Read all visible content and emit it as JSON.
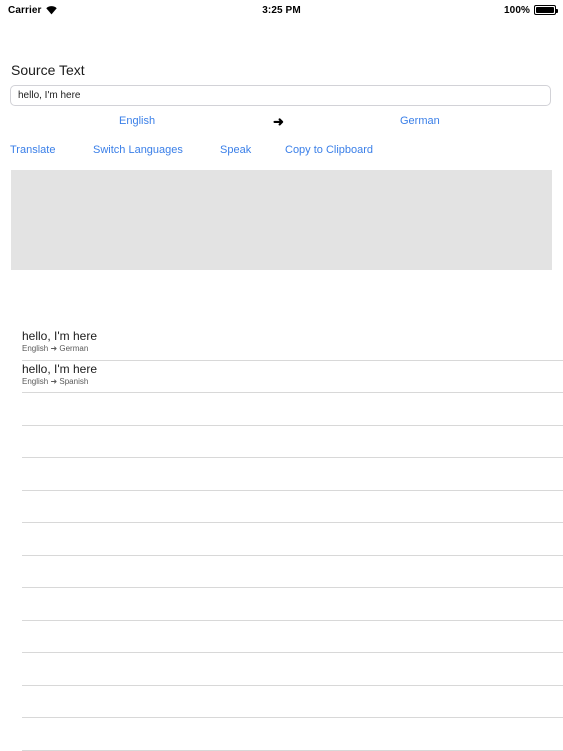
{
  "status_bar": {
    "carrier": "Carrier",
    "wifi_icon": "wifi-icon",
    "time": "3:25 PM",
    "battery_percent": "100%",
    "battery_icon": "battery-full-icon"
  },
  "source": {
    "label": "Source Text",
    "value": "hello, I'm here",
    "placeholder": "Source Text"
  },
  "languages": {
    "source_language": "English",
    "arrow": "➜",
    "target_language": "German"
  },
  "actions": [
    {
      "label": "Translate",
      "name": "translate-button"
    },
    {
      "label": "Switch Languages",
      "name": "switch-languages-button"
    },
    {
      "label": "Speak",
      "name": "speak-button"
    },
    {
      "label": "Copy to Clipboard",
      "name": "copy-to-clipboard-button"
    }
  ],
  "result": {
    "text": ""
  },
  "history": {
    "items": [
      {
        "title": "hello, I'm here",
        "subtitle": "English ➜ German"
      },
      {
        "title": "hello, I'm here",
        "subtitle": "English ➜ Spanish"
      }
    ],
    "empty_row_count": 11
  },
  "colors": {
    "link_blue": "#3a7fe8",
    "result_background": "#e3e3e3",
    "separator": "#d8d8d8",
    "text_primary": "#1c1c1c",
    "text_secondary": "#5a5a5a"
  }
}
